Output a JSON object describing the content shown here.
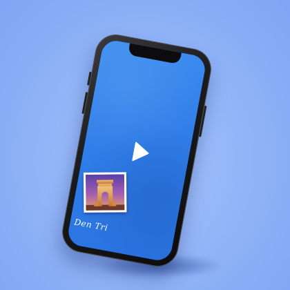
{
  "video": {
    "play_icon": "play-icon",
    "caption": "Den Tri",
    "thumbnail_icon": "india-gate-photo"
  },
  "colors": {
    "background": "#8fb2f7",
    "screen": "#2f7de8",
    "phone_frame": "#1b1c1f"
  }
}
